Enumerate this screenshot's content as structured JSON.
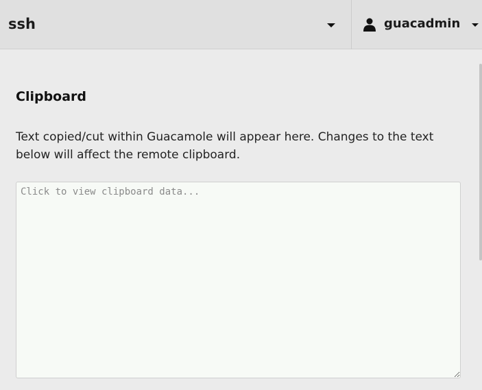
{
  "header": {
    "connection_name": "ssh",
    "username": "guacadmin"
  },
  "icons": {
    "title_dropdown": "caret-down-icon",
    "user": "user-icon",
    "user_dropdown": "caret-down-icon"
  },
  "clipboard": {
    "title": "Clipboard",
    "description": "Text copied/cut within Guacamole will appear here. Changes to the text below will affect the remote clipboard.",
    "placeholder": "Click to view clipboard data...",
    "value": ""
  },
  "colors": {
    "header_bg": "#e0e0e0",
    "panel_bg": "#ebebeb",
    "textarea_bg": "#f7faf6"
  }
}
